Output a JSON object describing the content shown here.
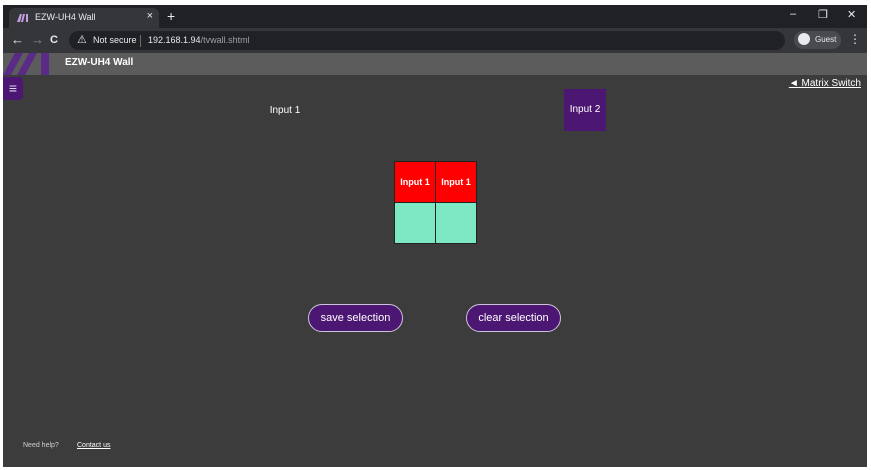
{
  "browser": {
    "tab_title": "EZW-UH4 Wall",
    "tab_close": "×",
    "new_tab": "+",
    "window": {
      "minimize": "–",
      "restore": "❐",
      "close": "✕"
    },
    "nav": {
      "back": "←",
      "forward": "→",
      "reload": "C"
    },
    "security_icon": "⚠",
    "security_text": "Not secure",
    "url_host": "192.168.1.94",
    "url_path": "/tvwall.shtml",
    "profile_label": "Guest",
    "menu": "⋮"
  },
  "app": {
    "title": "EZW-UH4 Wall",
    "menu_icon": "≡",
    "matrix_switch_link": "◄ Matrix Switch",
    "accent_color": "#4b1772"
  },
  "inputs": [
    {
      "label": "Input 1",
      "selected": false
    },
    {
      "label": "Input 2",
      "selected": true
    }
  ],
  "wall": {
    "cells": [
      {
        "label": "Input 1",
        "color": "#ff0000"
      },
      {
        "label": "Input 1",
        "color": "#ff0000"
      },
      {
        "label": "",
        "color": "#7ee8c4"
      },
      {
        "label": "",
        "color": "#7ee8c4"
      }
    ]
  },
  "actions": {
    "save_label": "save selection",
    "clear_label": "clear selection"
  },
  "footer": {
    "help_text": "Need help?",
    "contact_label": "Contact us"
  }
}
